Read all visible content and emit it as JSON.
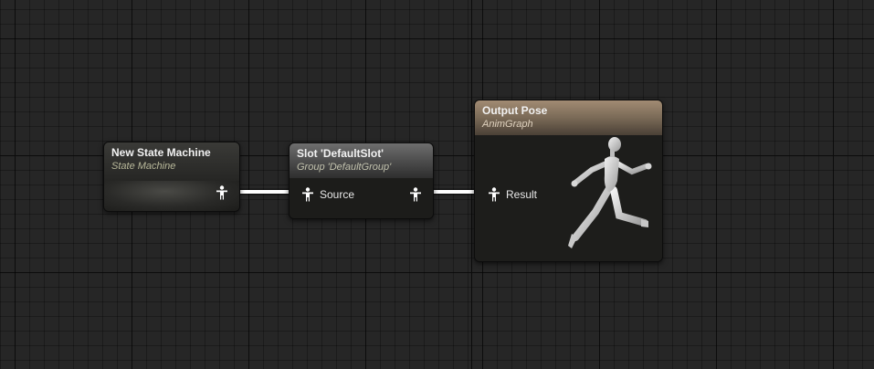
{
  "graph": {
    "nodes": {
      "state_machine": {
        "title": "New State Machine",
        "subtitle": "State Machine"
      },
      "slot": {
        "title": "Slot 'DefaultSlot'",
        "subtitle": "Group 'DefaultGroup'",
        "input_pin_label": "Source"
      },
      "output_pose": {
        "title": "Output Pose",
        "subtitle": "AnimGraph",
        "input_pin_label": "Result"
      }
    },
    "colors": {
      "background": "#262626",
      "wire": "#ffffff",
      "state_machine_header": "#2f2f2c",
      "slot_header": "#5b5b5b",
      "output_pose_header": "#7a6a57"
    },
    "icons": {
      "pose_pin": "pose-pin-icon",
      "output_figure": "running-mannequin-icon"
    }
  }
}
